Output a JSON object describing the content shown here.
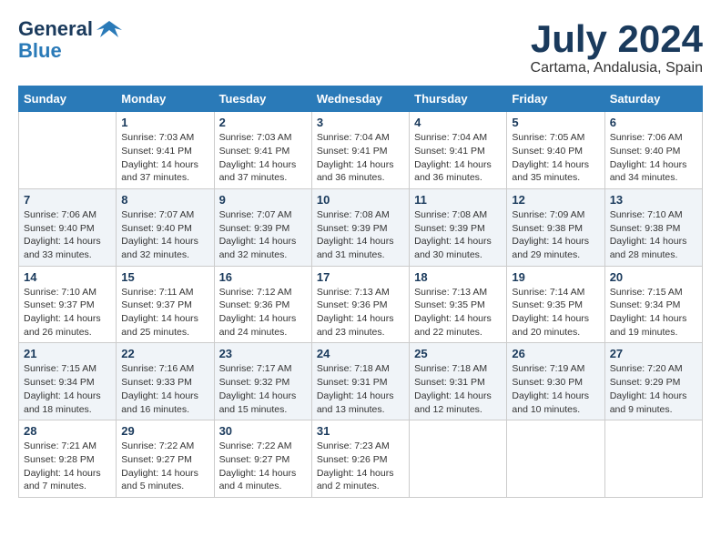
{
  "header": {
    "logo_line1": "General",
    "logo_line2": "Blue",
    "month": "July 2024",
    "location": "Cartama, Andalusia, Spain"
  },
  "days_of_week": [
    "Sunday",
    "Monday",
    "Tuesday",
    "Wednesday",
    "Thursday",
    "Friday",
    "Saturday"
  ],
  "weeks": [
    [
      {
        "day": "",
        "info": ""
      },
      {
        "day": "1",
        "info": "Sunrise: 7:03 AM\nSunset: 9:41 PM\nDaylight: 14 hours\nand 37 minutes."
      },
      {
        "day": "2",
        "info": "Sunrise: 7:03 AM\nSunset: 9:41 PM\nDaylight: 14 hours\nand 37 minutes."
      },
      {
        "day": "3",
        "info": "Sunrise: 7:04 AM\nSunset: 9:41 PM\nDaylight: 14 hours\nand 36 minutes."
      },
      {
        "day": "4",
        "info": "Sunrise: 7:04 AM\nSunset: 9:41 PM\nDaylight: 14 hours\nand 36 minutes."
      },
      {
        "day": "5",
        "info": "Sunrise: 7:05 AM\nSunset: 9:40 PM\nDaylight: 14 hours\nand 35 minutes."
      },
      {
        "day": "6",
        "info": "Sunrise: 7:06 AM\nSunset: 9:40 PM\nDaylight: 14 hours\nand 34 minutes."
      }
    ],
    [
      {
        "day": "7",
        "info": "Sunrise: 7:06 AM\nSunset: 9:40 PM\nDaylight: 14 hours\nand 33 minutes."
      },
      {
        "day": "8",
        "info": "Sunrise: 7:07 AM\nSunset: 9:40 PM\nDaylight: 14 hours\nand 32 minutes."
      },
      {
        "day": "9",
        "info": "Sunrise: 7:07 AM\nSunset: 9:39 PM\nDaylight: 14 hours\nand 32 minutes."
      },
      {
        "day": "10",
        "info": "Sunrise: 7:08 AM\nSunset: 9:39 PM\nDaylight: 14 hours\nand 31 minutes."
      },
      {
        "day": "11",
        "info": "Sunrise: 7:08 AM\nSunset: 9:39 PM\nDaylight: 14 hours\nand 30 minutes."
      },
      {
        "day": "12",
        "info": "Sunrise: 7:09 AM\nSunset: 9:38 PM\nDaylight: 14 hours\nand 29 minutes."
      },
      {
        "day": "13",
        "info": "Sunrise: 7:10 AM\nSunset: 9:38 PM\nDaylight: 14 hours\nand 28 minutes."
      }
    ],
    [
      {
        "day": "14",
        "info": "Sunrise: 7:10 AM\nSunset: 9:37 PM\nDaylight: 14 hours\nand 26 minutes."
      },
      {
        "day": "15",
        "info": "Sunrise: 7:11 AM\nSunset: 9:37 PM\nDaylight: 14 hours\nand 25 minutes."
      },
      {
        "day": "16",
        "info": "Sunrise: 7:12 AM\nSunset: 9:36 PM\nDaylight: 14 hours\nand 24 minutes."
      },
      {
        "day": "17",
        "info": "Sunrise: 7:13 AM\nSunset: 9:36 PM\nDaylight: 14 hours\nand 23 minutes."
      },
      {
        "day": "18",
        "info": "Sunrise: 7:13 AM\nSunset: 9:35 PM\nDaylight: 14 hours\nand 22 minutes."
      },
      {
        "day": "19",
        "info": "Sunrise: 7:14 AM\nSunset: 9:35 PM\nDaylight: 14 hours\nand 20 minutes."
      },
      {
        "day": "20",
        "info": "Sunrise: 7:15 AM\nSunset: 9:34 PM\nDaylight: 14 hours\nand 19 minutes."
      }
    ],
    [
      {
        "day": "21",
        "info": "Sunrise: 7:15 AM\nSunset: 9:34 PM\nDaylight: 14 hours\nand 18 minutes."
      },
      {
        "day": "22",
        "info": "Sunrise: 7:16 AM\nSunset: 9:33 PM\nDaylight: 14 hours\nand 16 minutes."
      },
      {
        "day": "23",
        "info": "Sunrise: 7:17 AM\nSunset: 9:32 PM\nDaylight: 14 hours\nand 15 minutes."
      },
      {
        "day": "24",
        "info": "Sunrise: 7:18 AM\nSunset: 9:31 PM\nDaylight: 14 hours\nand 13 minutes."
      },
      {
        "day": "25",
        "info": "Sunrise: 7:18 AM\nSunset: 9:31 PM\nDaylight: 14 hours\nand 12 minutes."
      },
      {
        "day": "26",
        "info": "Sunrise: 7:19 AM\nSunset: 9:30 PM\nDaylight: 14 hours\nand 10 minutes."
      },
      {
        "day": "27",
        "info": "Sunrise: 7:20 AM\nSunset: 9:29 PM\nDaylight: 14 hours\nand 9 minutes."
      }
    ],
    [
      {
        "day": "28",
        "info": "Sunrise: 7:21 AM\nSunset: 9:28 PM\nDaylight: 14 hours\nand 7 minutes."
      },
      {
        "day": "29",
        "info": "Sunrise: 7:22 AM\nSunset: 9:27 PM\nDaylight: 14 hours\nand 5 minutes."
      },
      {
        "day": "30",
        "info": "Sunrise: 7:22 AM\nSunset: 9:27 PM\nDaylight: 14 hours\nand 4 minutes."
      },
      {
        "day": "31",
        "info": "Sunrise: 7:23 AM\nSunset: 9:26 PM\nDaylight: 14 hours\nand 2 minutes."
      },
      {
        "day": "",
        "info": ""
      },
      {
        "day": "",
        "info": ""
      },
      {
        "day": "",
        "info": ""
      }
    ]
  ]
}
